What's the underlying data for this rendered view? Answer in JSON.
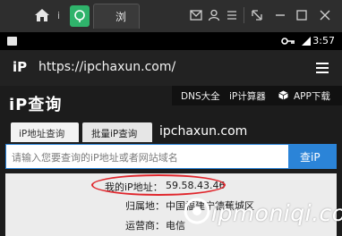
{
  "emulator": {
    "app_tab_icon": "green-app-icon",
    "browser_tab_label": "浏",
    "info_label": "i"
  },
  "status_bar": {
    "time": "3:57"
  },
  "browser": {
    "site_logo": "iP",
    "url": "https://ipchaxun.com/"
  },
  "site": {
    "brand": "iP查询",
    "nav": {
      "dns": "DNS大全",
      "calc": "iP计算器",
      "app": "APP下载"
    },
    "tabs": {
      "ip_lookup": "iP地址查询",
      "batch": "批量iP查询"
    },
    "domain": "ipchaxun.com",
    "search": {
      "placeholder": "请输入您要查询的iP地址或者网站域名",
      "button": "查iP"
    },
    "result": {
      "my_ip_label": "我的iP地址：",
      "my_ip_value": "59.58.43.46",
      "location_label": "归属地：",
      "location_value": "中国福建宁德蕉城区",
      "isp_label": "运营商：",
      "isp_value": "电信"
    }
  },
  "watermark": {
    "text": "ipmoniqi.com"
  },
  "colors": {
    "accent": "#2b84d8",
    "highlight_oval": "#e0262c",
    "app_green": "#2fb36b"
  }
}
